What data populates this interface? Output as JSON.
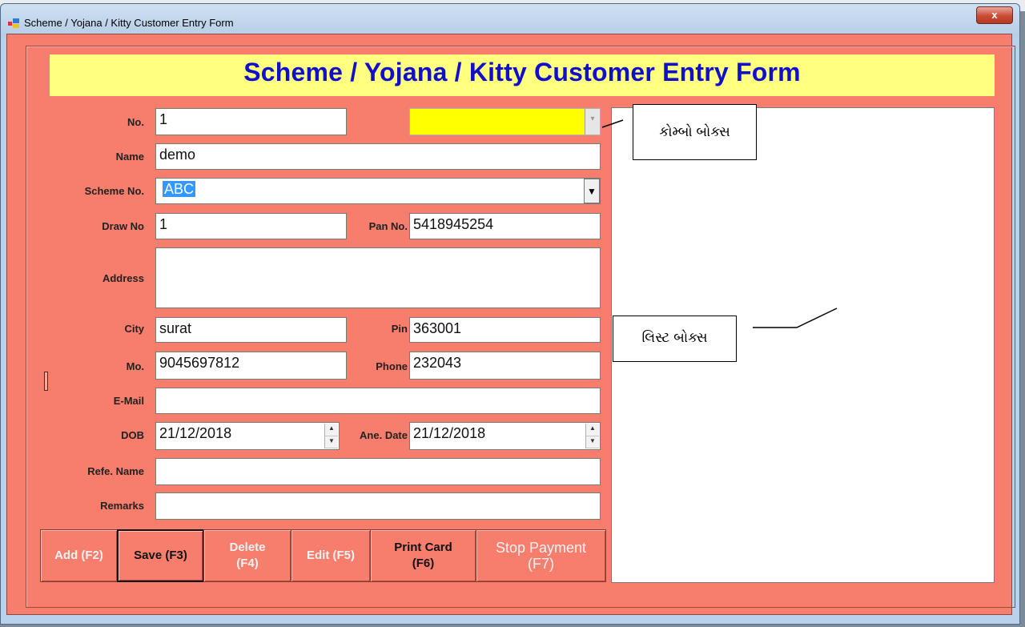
{
  "window": {
    "title": "Scheme / Yojana / Kitty Customer Entry Form",
    "close": "x"
  },
  "header": {
    "title": "Scheme / Yojana / Kitty Customer Entry Form"
  },
  "fields": {
    "no": {
      "label": "No.",
      "value": "1"
    },
    "name": {
      "label": "Name",
      "value": "demo"
    },
    "scheme_no": {
      "label": "Scheme No.",
      "value": "ABC"
    },
    "draw_no": {
      "label": "Draw No",
      "value": "1"
    },
    "pan_no": {
      "label": "Pan No.",
      "value": "5418945254"
    },
    "address": {
      "label": "Address",
      "value": ""
    },
    "city": {
      "label": "City",
      "value": "surat"
    },
    "pin": {
      "label": "Pin",
      "value": "363001"
    },
    "mo": {
      "label": "Mo.",
      "value": "9045697812"
    },
    "phone": {
      "label": "Phone",
      "value": "232043"
    },
    "email": {
      "label": "E-Mail",
      "value": ""
    },
    "dob": {
      "label": "DOB",
      "value": "21/12/2018"
    },
    "ane_date": {
      "label": "Ane. Date",
      "value": "21/12/2018"
    },
    "refe_name": {
      "label": "Refe. Name",
      "value": ""
    },
    "remarks": {
      "label": "Remarks",
      "value": ""
    }
  },
  "buttons": {
    "add": "Add (F2)",
    "save": "Save (F3)",
    "delete_1": "Delete",
    "delete_2": "(F4)",
    "edit": "Edit (F5)",
    "print_1": "Print Card",
    "print_2": "(F6)",
    "stop_1": "Stop Payment",
    "stop_2": "(F7)"
  },
  "annotations": {
    "combo_box": "કોમ્બો બોક્સ",
    "list_box": "લિસ્ટ બોક્સ"
  },
  "colors": {
    "form_bg": "#f77d6d",
    "header_bg": "#ffff80",
    "title_color": "#1010cc",
    "combo_highlight": "#ffff00",
    "selection": "#3399ff"
  }
}
